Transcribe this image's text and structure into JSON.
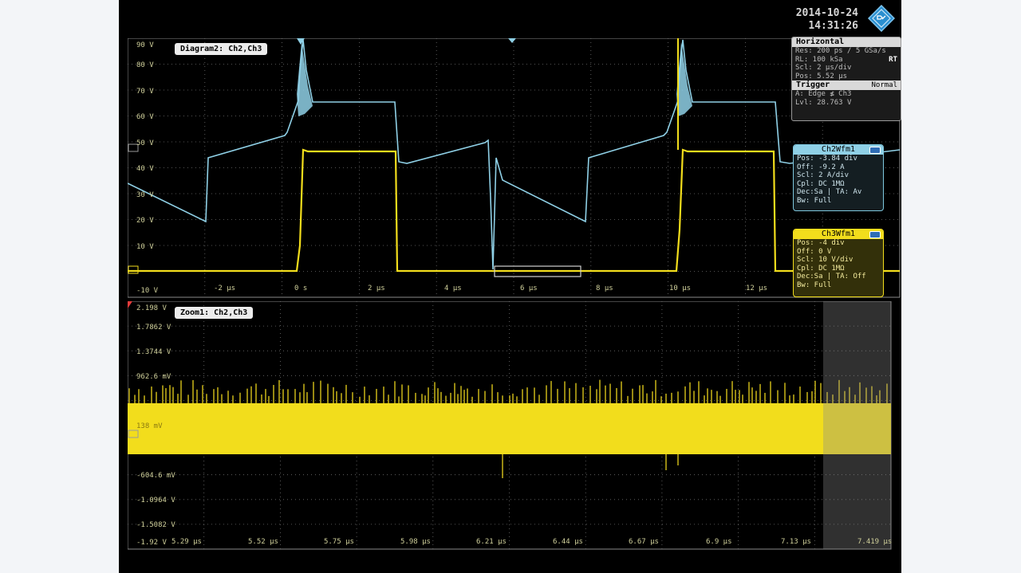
{
  "header": {
    "date": "2014-10-24",
    "time": "14:31:26",
    "logo_icon": "rohde-schwarz-logo-icon"
  },
  "diagram2": {
    "label": "Diagram2: Ch2,Ch3",
    "y_labels": [
      "90 V",
      "80 V",
      "70 V",
      "60 V",
      "50 V",
      "40 V",
      "30 V",
      "20 V",
      "10 V",
      "-10 V"
    ],
    "x_labels": [
      "-2 µs",
      "0 s",
      "2 µs",
      "4 µs",
      "6 µs",
      "8 µs",
      "10 µs",
      "12 µs"
    ]
  },
  "zoom1": {
    "label": "Zoom1: Ch2,Ch3",
    "y_labels": [
      "2.198 V",
      "1.7862 V",
      "1.3744 V",
      "962.6 mV",
      "",
      "138 mV",
      "",
      "-604.6 mV",
      "-1.0964 V",
      "-1.5082 V",
      "-1.92 V"
    ],
    "x_labels": [
      "5.29 µs",
      "5.52 µs",
      "5.75 µs",
      "5.98 µs",
      "6.21 µs",
      "6.44 µs",
      "6.67 µs",
      "6.9 µs",
      "7.13 µs",
      "7.419 µs"
    ]
  },
  "horizontal": {
    "title": "Horizontal",
    "res": "Res: 200 ps / 5 GSa/s",
    "rl": "RL:  100 kSa",
    "rt": "RT",
    "scl": "Scl:  2 µs/div",
    "pos": "Pos:  5.52 µs"
  },
  "trigger": {
    "title": "Trigger",
    "mode": "Normal",
    "source": "A:   Edge  ≰ Ch3",
    "level": "Lvl:  28.763 V"
  },
  "ch2wfm": {
    "title": "Ch2Wfm1",
    "rows": [
      "Pos:  -3.84 div",
      "Off:  -9.2 A",
      "Scl:  2 A/div",
      "Cpl:  DC 1MΩ",
      "Dec:Sa | TA: Av",
      "Bw:  Full"
    ]
  },
  "ch3wfm": {
    "title": "Ch3Wfm1",
    "rows": [
      "Pos:  -4 div",
      "Off:  0 V",
      "Scl:  10 V/div",
      "Cpl:  DC 1MΩ",
      "Dec:Sa | TA: Off",
      "Bw:  Full"
    ]
  },
  "colors": {
    "ch2": "#8fd0e6",
    "ch3": "#f2dd1c",
    "grid": "#8a8a8a",
    "background": "#000000"
  }
}
